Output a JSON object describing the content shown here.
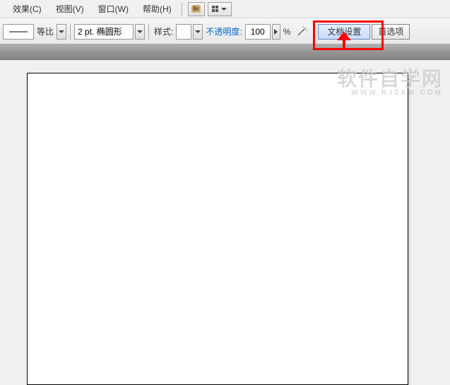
{
  "menubar": {
    "items": [
      {
        "label": "效果(C)"
      },
      {
        "label": "视图(V)"
      },
      {
        "label": "窗口(W)"
      },
      {
        "label": "帮助(H)"
      }
    ],
    "br_label": "Br"
  },
  "controlbar": {
    "uniform_label": "等比",
    "stroke_value": "2 pt. 椭圆形",
    "style_label": "样式:",
    "opacity_label": "不透明度:",
    "opacity_value": "100",
    "opacity_unit": "%",
    "doc_setup_label": "文档设置",
    "preferences_label": "首选项"
  },
  "watermark": {
    "main": "软件自学网",
    "sub": "WWW.RJZXW.COM"
  }
}
